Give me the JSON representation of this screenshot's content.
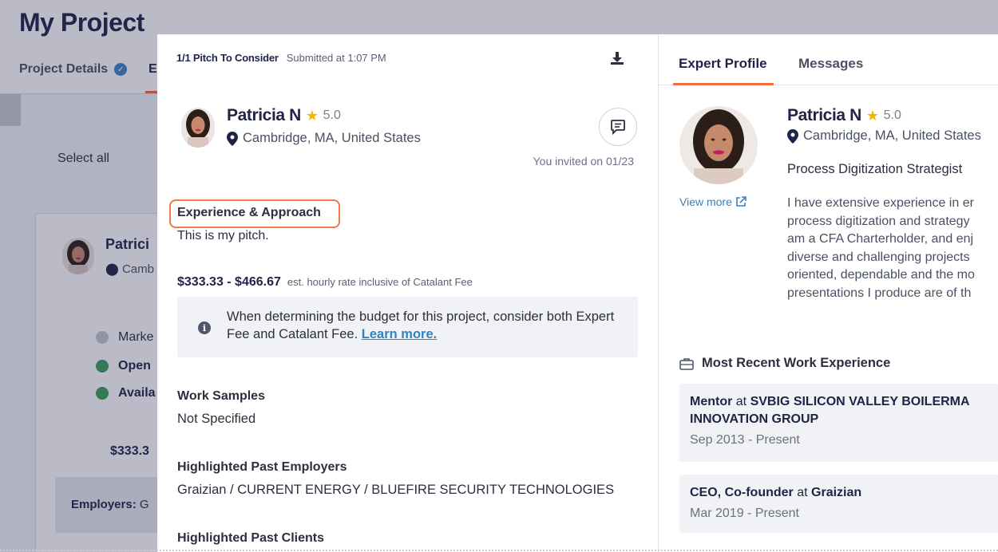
{
  "background": {
    "page_title": "My Project",
    "tab_details": "Project Details",
    "tab_active_initial": "E",
    "select_all": "Select all",
    "card": {
      "name": "Patrici",
      "location": "Camb",
      "rows": [
        "Marke",
        "Open",
        "Availa"
      ],
      "price": "$333.3",
      "employers_label": "Employers:",
      "employers_value": "G"
    }
  },
  "pitch": {
    "header_count": "1/1 Pitch To Consider",
    "header_submitted": "Submitted at 1:07 PM",
    "expert_name": "Patricia N",
    "rating": "5.0",
    "location": "Cambridge, MA, United States",
    "invited": "You invited on 01/23",
    "experience_title": "Experience & Approach",
    "experience_body": "This is my pitch.",
    "rate_range": "$333.33 - $466.67",
    "rate_note": "est. hourly rate inclusive of Catalant Fee",
    "info_text": "When determining the budget for this project, consider both Expert Fee and Catalant Fee.",
    "info_link": "Learn more.",
    "work_samples_title": "Work Samples",
    "work_samples_value": "Not Specified",
    "employers_title": "Highlighted Past Employers",
    "employers_value": "Graizian / CURRENT ENERGY / BLUEFIRE SECURITY TECHNOLOGIES",
    "clients_title": "Highlighted Past Clients"
  },
  "profile": {
    "tab_profile": "Expert Profile",
    "tab_messages": "Messages",
    "name": "Patricia N",
    "rating": "5.0",
    "location": "Cambridge, MA, United States",
    "role": "Process Digitization Strategist",
    "view_more": "View more",
    "bio_lines": [
      "I have extensive experience in er",
      "process digitization and strategy",
      "am a CFA Charterholder, and enj",
      "diverse and challenging projects",
      "oriented, dependable and the mo",
      "presentations I produce are of th"
    ],
    "work_title": "Most Recent Work Experience",
    "jobs": [
      {
        "role": "Mentor",
        "at": "at",
        "company_line1": "SVBIG SILICON VALLEY BOILERMA",
        "company_line2": "INNOVATION GROUP",
        "dates": "Sep 2013 - Present"
      },
      {
        "role": "CEO, Co-founder",
        "at": "at",
        "company_line1": "Graizian",
        "company_line2": "",
        "dates": "Mar 2019 - Present"
      }
    ]
  },
  "colors": {
    "accent_orange": "#ef6c3a",
    "link_blue": "#2f84c4",
    "star": "#f5b400",
    "heading_navy": "#1e2347"
  }
}
